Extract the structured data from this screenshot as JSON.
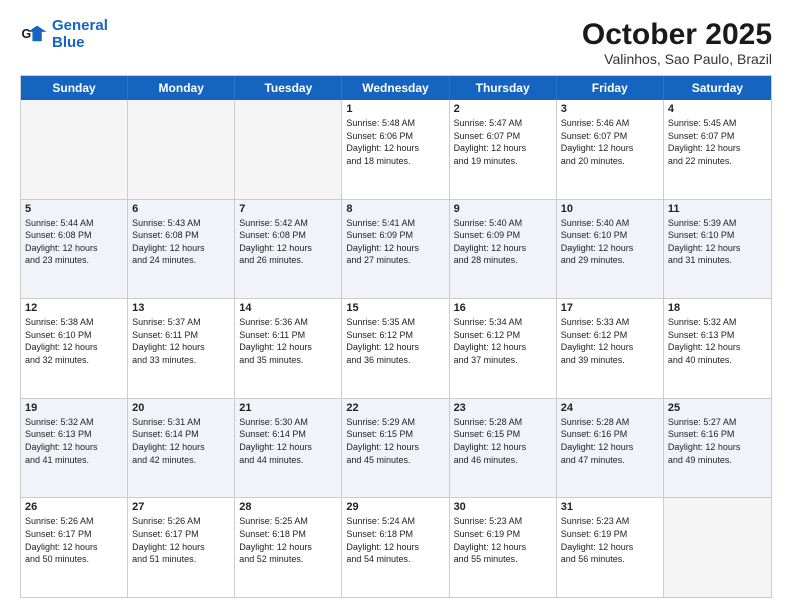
{
  "header": {
    "logo_line1": "General",
    "logo_line2": "Blue",
    "month_title": "October 2025",
    "location": "Valinhos, Sao Paulo, Brazil"
  },
  "day_headers": [
    "Sunday",
    "Monday",
    "Tuesday",
    "Wednesday",
    "Thursday",
    "Friday",
    "Saturday"
  ],
  "weeks": [
    {
      "days": [
        {
          "num": "",
          "info": "",
          "empty": true
        },
        {
          "num": "",
          "info": "",
          "empty": true
        },
        {
          "num": "",
          "info": "",
          "empty": true
        },
        {
          "num": "1",
          "info": "Sunrise: 5:48 AM\nSunset: 6:06 PM\nDaylight: 12 hours\nand 18 minutes."
        },
        {
          "num": "2",
          "info": "Sunrise: 5:47 AM\nSunset: 6:07 PM\nDaylight: 12 hours\nand 19 minutes."
        },
        {
          "num": "3",
          "info": "Sunrise: 5:46 AM\nSunset: 6:07 PM\nDaylight: 12 hours\nand 20 minutes."
        },
        {
          "num": "4",
          "info": "Sunrise: 5:45 AM\nSunset: 6:07 PM\nDaylight: 12 hours\nand 22 minutes."
        }
      ]
    },
    {
      "days": [
        {
          "num": "5",
          "info": "Sunrise: 5:44 AM\nSunset: 6:08 PM\nDaylight: 12 hours\nand 23 minutes."
        },
        {
          "num": "6",
          "info": "Sunrise: 5:43 AM\nSunset: 6:08 PM\nDaylight: 12 hours\nand 24 minutes."
        },
        {
          "num": "7",
          "info": "Sunrise: 5:42 AM\nSunset: 6:08 PM\nDaylight: 12 hours\nand 26 minutes."
        },
        {
          "num": "8",
          "info": "Sunrise: 5:41 AM\nSunset: 6:09 PM\nDaylight: 12 hours\nand 27 minutes."
        },
        {
          "num": "9",
          "info": "Sunrise: 5:40 AM\nSunset: 6:09 PM\nDaylight: 12 hours\nand 28 minutes."
        },
        {
          "num": "10",
          "info": "Sunrise: 5:40 AM\nSunset: 6:10 PM\nDaylight: 12 hours\nand 29 minutes."
        },
        {
          "num": "11",
          "info": "Sunrise: 5:39 AM\nSunset: 6:10 PM\nDaylight: 12 hours\nand 31 minutes."
        }
      ]
    },
    {
      "days": [
        {
          "num": "12",
          "info": "Sunrise: 5:38 AM\nSunset: 6:10 PM\nDaylight: 12 hours\nand 32 minutes."
        },
        {
          "num": "13",
          "info": "Sunrise: 5:37 AM\nSunset: 6:11 PM\nDaylight: 12 hours\nand 33 minutes."
        },
        {
          "num": "14",
          "info": "Sunrise: 5:36 AM\nSunset: 6:11 PM\nDaylight: 12 hours\nand 35 minutes."
        },
        {
          "num": "15",
          "info": "Sunrise: 5:35 AM\nSunset: 6:12 PM\nDaylight: 12 hours\nand 36 minutes."
        },
        {
          "num": "16",
          "info": "Sunrise: 5:34 AM\nSunset: 6:12 PM\nDaylight: 12 hours\nand 37 minutes."
        },
        {
          "num": "17",
          "info": "Sunrise: 5:33 AM\nSunset: 6:12 PM\nDaylight: 12 hours\nand 39 minutes."
        },
        {
          "num": "18",
          "info": "Sunrise: 5:32 AM\nSunset: 6:13 PM\nDaylight: 12 hours\nand 40 minutes."
        }
      ]
    },
    {
      "days": [
        {
          "num": "19",
          "info": "Sunrise: 5:32 AM\nSunset: 6:13 PM\nDaylight: 12 hours\nand 41 minutes."
        },
        {
          "num": "20",
          "info": "Sunrise: 5:31 AM\nSunset: 6:14 PM\nDaylight: 12 hours\nand 42 minutes."
        },
        {
          "num": "21",
          "info": "Sunrise: 5:30 AM\nSunset: 6:14 PM\nDaylight: 12 hours\nand 44 minutes."
        },
        {
          "num": "22",
          "info": "Sunrise: 5:29 AM\nSunset: 6:15 PM\nDaylight: 12 hours\nand 45 minutes."
        },
        {
          "num": "23",
          "info": "Sunrise: 5:28 AM\nSunset: 6:15 PM\nDaylight: 12 hours\nand 46 minutes."
        },
        {
          "num": "24",
          "info": "Sunrise: 5:28 AM\nSunset: 6:16 PM\nDaylight: 12 hours\nand 47 minutes."
        },
        {
          "num": "25",
          "info": "Sunrise: 5:27 AM\nSunset: 6:16 PM\nDaylight: 12 hours\nand 49 minutes."
        }
      ]
    },
    {
      "days": [
        {
          "num": "26",
          "info": "Sunrise: 5:26 AM\nSunset: 6:17 PM\nDaylight: 12 hours\nand 50 minutes."
        },
        {
          "num": "27",
          "info": "Sunrise: 5:26 AM\nSunset: 6:17 PM\nDaylight: 12 hours\nand 51 minutes."
        },
        {
          "num": "28",
          "info": "Sunrise: 5:25 AM\nSunset: 6:18 PM\nDaylight: 12 hours\nand 52 minutes."
        },
        {
          "num": "29",
          "info": "Sunrise: 5:24 AM\nSunset: 6:18 PM\nDaylight: 12 hours\nand 54 minutes."
        },
        {
          "num": "30",
          "info": "Sunrise: 5:23 AM\nSunset: 6:19 PM\nDaylight: 12 hours\nand 55 minutes."
        },
        {
          "num": "31",
          "info": "Sunrise: 5:23 AM\nSunset: 6:19 PM\nDaylight: 12 hours\nand 56 minutes."
        },
        {
          "num": "",
          "info": "",
          "empty": true
        }
      ]
    }
  ]
}
